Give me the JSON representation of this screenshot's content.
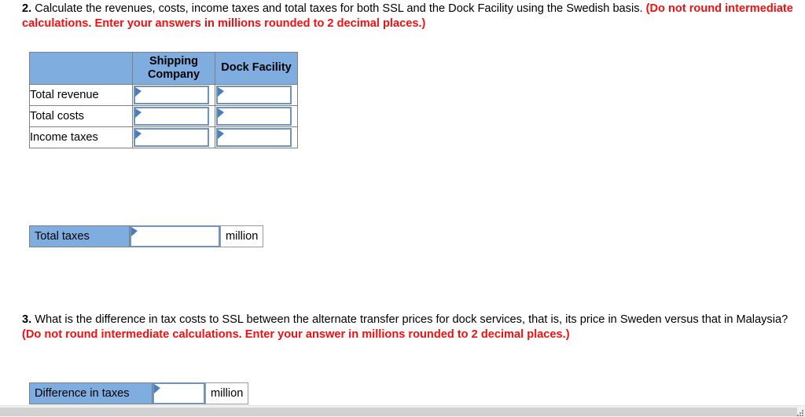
{
  "questions": [
    {
      "number": "2.",
      "text_black": " Calculate the revenues, costs, income taxes and total taxes for both SSL and the Dock Facility using the Swedish basis. ",
      "text_red": "(Do not round intermediate calculations. Enter your answers in millions rounded to 2 decimal places.)"
    },
    {
      "number": "3.",
      "text_black": " What is the difference in tax costs to SSL between the alternate transfer prices for dock services, that is, its price in Sweden versus that in Malaysia? ",
      "text_red": "(Do not round intermediate calculations. Enter your answer in millions rounded to 2 decimal places.)"
    }
  ],
  "answer_table": {
    "corner_header": "",
    "column_headers": [
      "Shipping Company",
      "Dock Facility"
    ],
    "rows": [
      {
        "label": "Total revenue",
        "shipping_value": "",
        "dock_value": ""
      },
      {
        "label": "Total costs",
        "shipping_value": "",
        "dock_value": ""
      },
      {
        "label": "Income taxes",
        "shipping_value": "",
        "dock_value": ""
      }
    ]
  },
  "total_taxes": {
    "label": "Total taxes",
    "value": "",
    "unit": "million"
  },
  "difference_taxes": {
    "label": "Difference in taxes",
    "value": "",
    "unit": "million"
  },
  "colors": {
    "header_blue": "#80ADE0",
    "field_border_blue": "#6E93BE",
    "flag_blue": "#4A7EBB",
    "red_emphasis": "#EE1111",
    "cell_border_gray": "#808080"
  }
}
